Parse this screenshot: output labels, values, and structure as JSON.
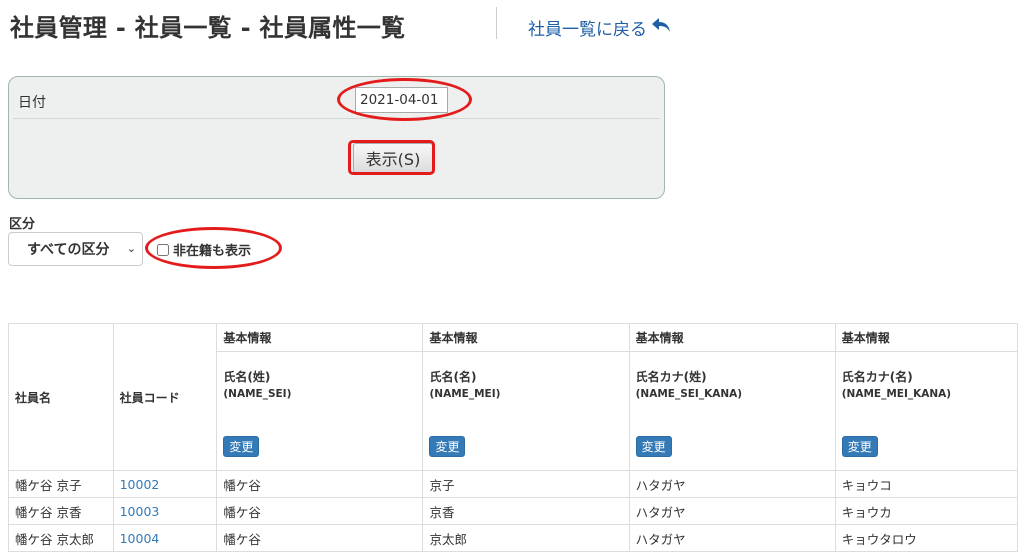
{
  "header": {
    "title": "社員管理 - 社員一覧 - 社員属性一覧",
    "back_link": "社員一覧に戻る"
  },
  "search": {
    "date_label": "日付",
    "date_value": "2021-04-01",
    "show_button": "表示(S)"
  },
  "filter": {
    "division_label": "区分",
    "division_selected": "すべての区分",
    "include_inactive_label": "非在籍も表示",
    "include_inactive_checked": false
  },
  "table": {
    "col_name": "社員名",
    "col_code": "社員コード",
    "attribute_columns": [
      {
        "group": "基本情報",
        "field": "氏名(姓)",
        "code": "(NAME_SEI)",
        "button": "変更"
      },
      {
        "group": "基本情報",
        "field": "氏名(名)",
        "code": "(NAME_MEI)",
        "button": "変更"
      },
      {
        "group": "基本情報",
        "field": "氏名カナ(姓)",
        "code": "(NAME_SEI_KANA)",
        "button": "変更"
      },
      {
        "group": "基本情報",
        "field": "氏名カナ(名)",
        "code": "(NAME_MEI_KANA)",
        "button": "変更"
      }
    ],
    "rows": [
      {
        "name": "幡ケ谷 京子",
        "code": "10002",
        "values": [
          "幡ケ谷",
          "京子",
          "ハタガヤ",
          "キョウコ"
        ]
      },
      {
        "name": "幡ケ谷 京香",
        "code": "10003",
        "values": [
          "幡ケ谷",
          "京香",
          "ハタガヤ",
          "キョウカ"
        ]
      },
      {
        "name": "幡ケ谷 京太郎",
        "code": "10004",
        "values": [
          "幡ケ谷",
          "京太郎",
          "ハタガヤ",
          "キョウタロウ"
        ]
      }
    ]
  }
}
